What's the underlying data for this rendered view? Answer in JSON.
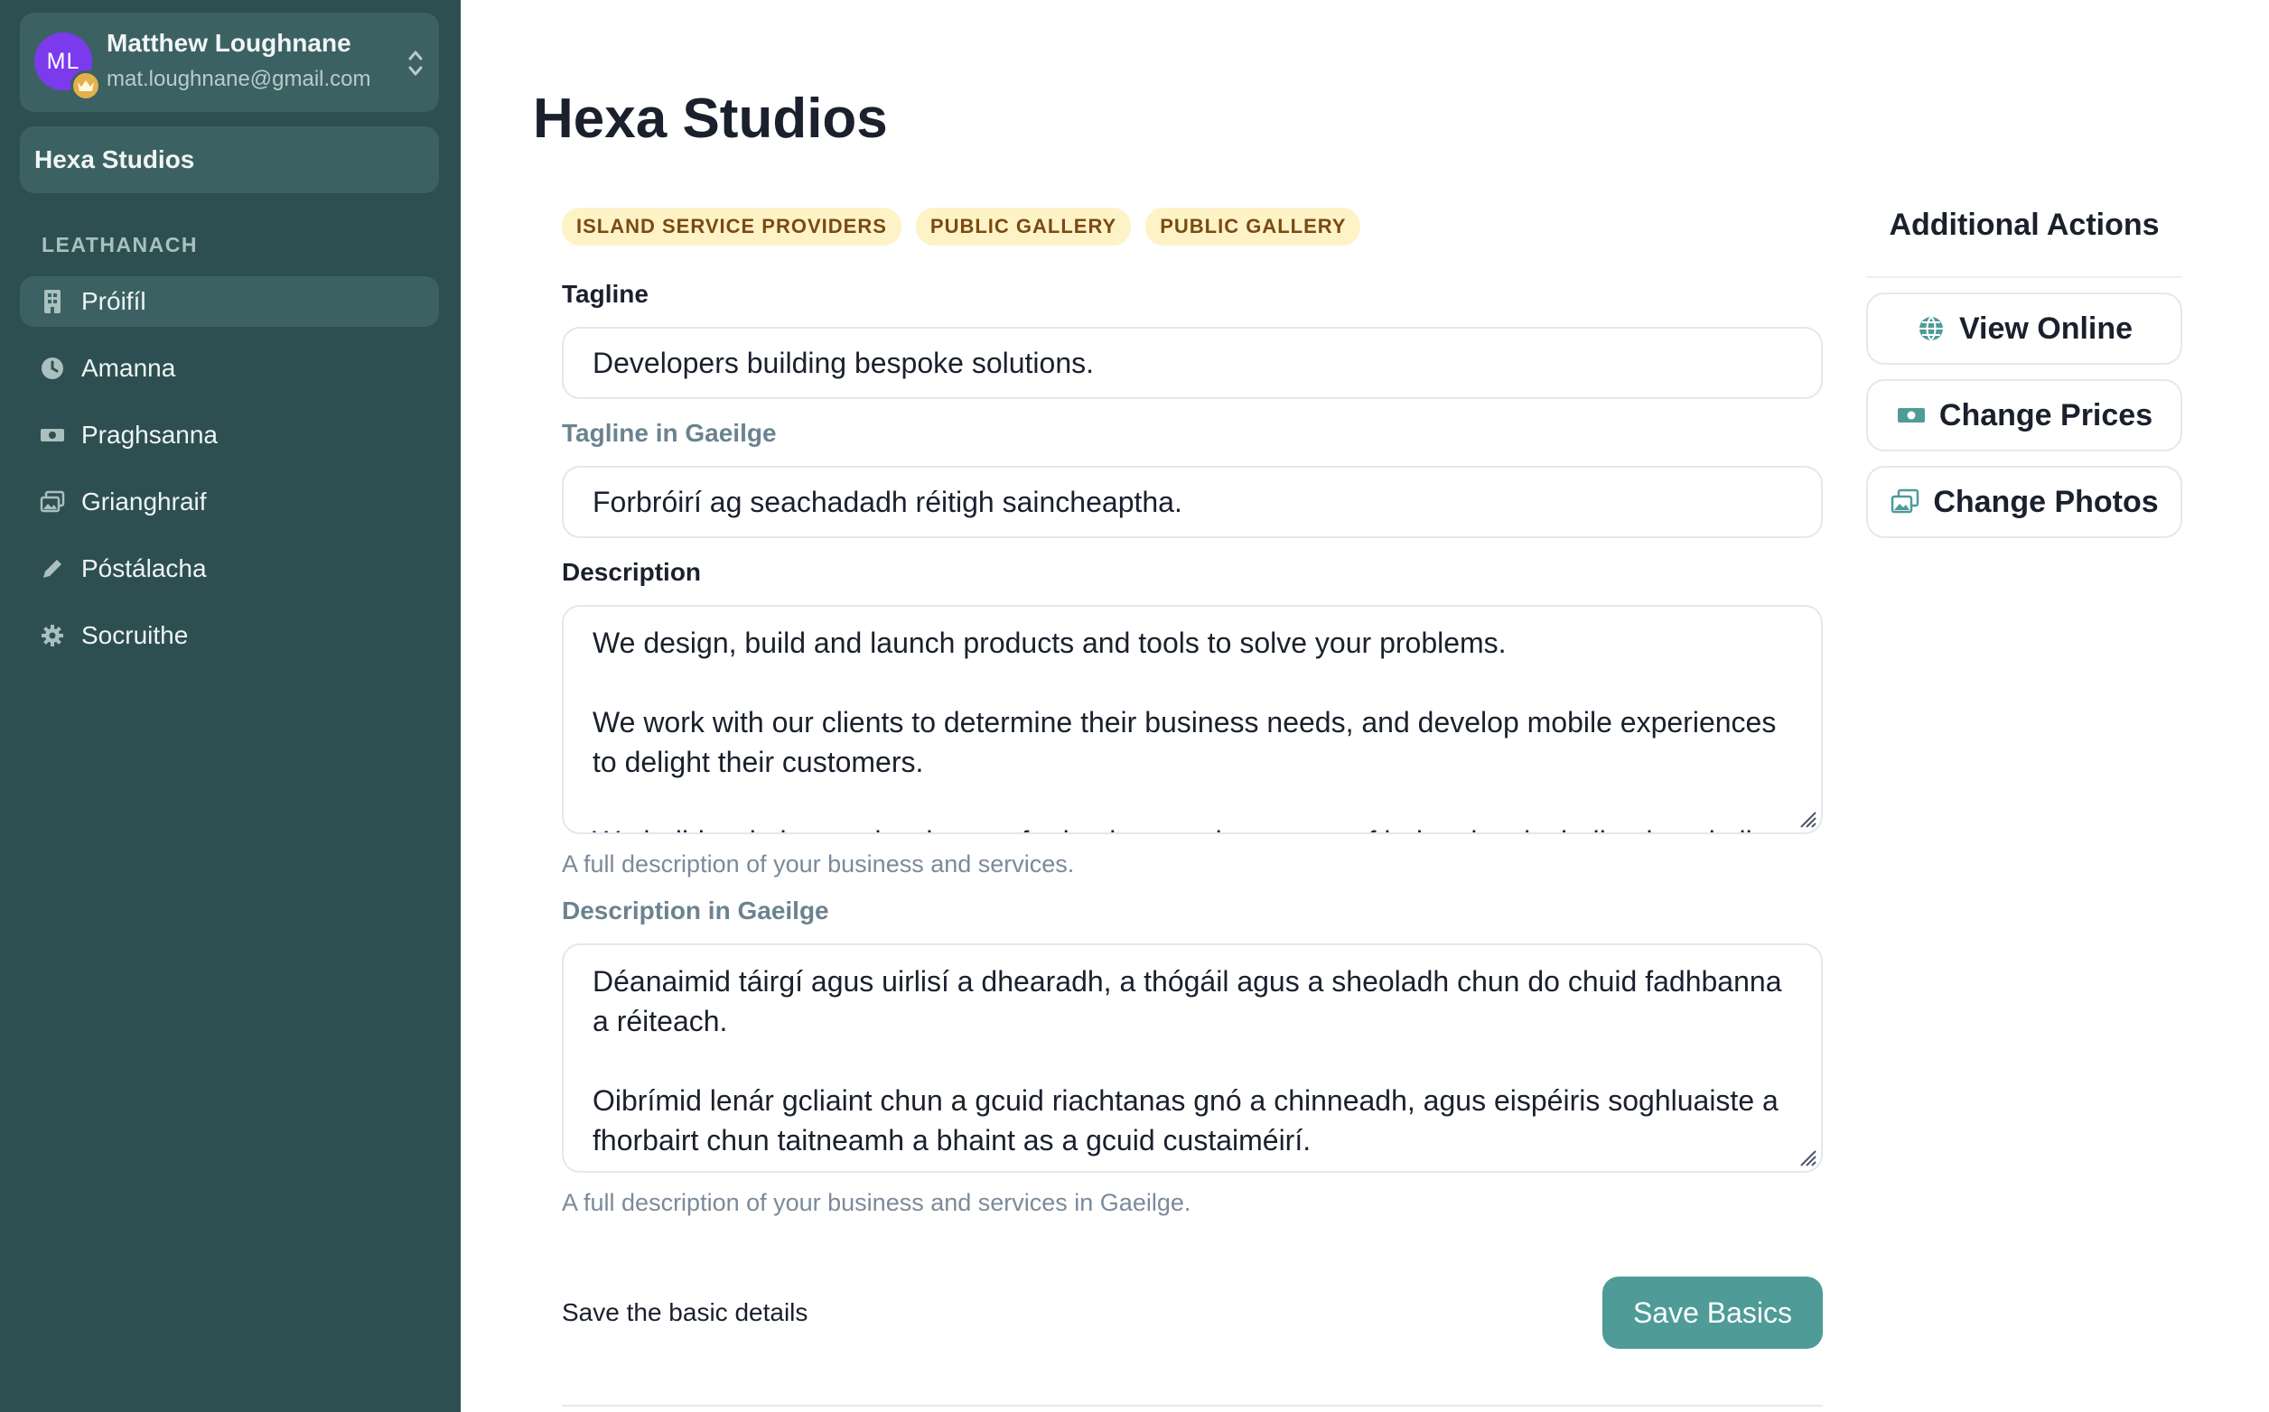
{
  "account": {
    "initials": "ML",
    "name": "Matthew Loughnane",
    "email": "mat.loughnane@gmail.com"
  },
  "studio": {
    "name": "Hexa Studios"
  },
  "nav": {
    "heading": "LEATHANACH",
    "items": [
      {
        "label": "Próifíl",
        "icon": "building-icon",
        "active": true
      },
      {
        "label": "Amanna",
        "icon": "clock-icon"
      },
      {
        "label": "Praghsanna",
        "icon": "cash-icon"
      },
      {
        "label": "Grianghraif",
        "icon": "photos-icon"
      },
      {
        "label": "Póstálacha",
        "icon": "pencil-icon"
      },
      {
        "label": "Socruithe",
        "icon": "gear-icon"
      }
    ]
  },
  "page": {
    "title": "Hexa Studios"
  },
  "badges": [
    "ISLAND SERVICE PROVIDERS",
    "PUBLIC GALLERY",
    "PUBLIC GALLERY"
  ],
  "form": {
    "tagline": {
      "label": "Tagline",
      "value": "Developers building bespoke solutions."
    },
    "tagline_ga": {
      "label": "Tagline in Gaeilge",
      "value": "Forbróirí ag seachadadh réitigh saincheaptha."
    },
    "description": {
      "label": "Description",
      "p1": "We design, build and launch products and tools to solve your problems.",
      "p2": "We work with our clients to determine their business needs, and develop mobile experiences to delight their customers.",
      "p3": "We build websites and web apps for businesses in a range of industries, including hospitality",
      "help": "A full description of your business and services."
    },
    "description_ga": {
      "label": "Description in Gaeilge",
      "p1": "Déanaimid táirgí agus uirlisí a dhearadh, a thógáil agus a sheoladh chun do chuid fadhbanna a réiteach.",
      "p2": "Oibrímid lenár gcliaint chun a gcuid riachtanas gnó a chinneadh, agus eispéiris soghluaiste a fhorbairt chun taitneamh a bhaint as a gcuid custaiméirí.",
      "help": "A full description of your business and services in Gaeilge."
    },
    "save_text": "Save the basic details",
    "save_button": "Save Basics"
  },
  "actions": {
    "title": "Additional Actions",
    "view_online": "View Online",
    "change_prices": "Change Prices",
    "change_photos": "Change Photos"
  },
  "colors": {
    "sidebar": "#2e4f52",
    "sidebar_item": "#3c6163",
    "accent": "#4e9b98",
    "badge_bg": "#fef3c7",
    "avatar": "#7c3aed"
  }
}
